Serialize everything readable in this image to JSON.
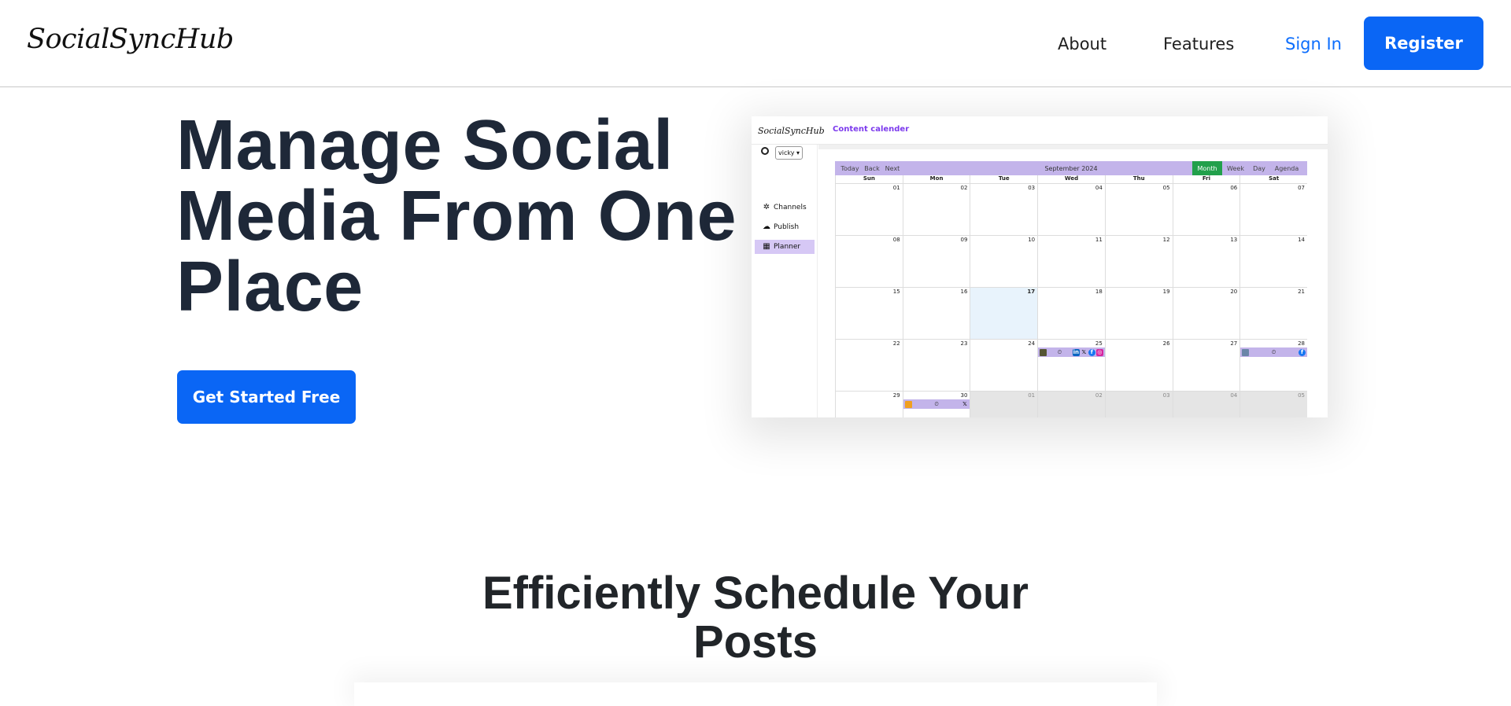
{
  "nav": {
    "brand": "SocialSyncHub",
    "about": "About",
    "features": "Features",
    "sign_in": "Sign In",
    "register": "Register"
  },
  "hero": {
    "title": "Manage Social Media From One Place",
    "cta": "Get Started Free"
  },
  "preview": {
    "brand": "SocialSyncHub",
    "heading": "Content calender",
    "user": "vicky ▾",
    "sidebar": [
      {
        "label": "Channels",
        "icon": "asterisk-icon"
      },
      {
        "label": "Publish",
        "icon": "cloud-icon"
      },
      {
        "label": "Planner",
        "icon": "calendar-icon"
      }
    ],
    "toolbar": {
      "today": "Today",
      "back": "Back",
      "next": "Next",
      "month_label": "September 2024",
      "views": [
        "Month",
        "Week",
        "Day",
        "Agenda"
      ],
      "active_view": "Month"
    },
    "weekdays": [
      "Sun",
      "Mon",
      "Tue",
      "Wed",
      "Thu",
      "Fri",
      "Sat"
    ],
    "weeks": [
      [
        "01",
        "02",
        "03",
        "04",
        "05",
        "06",
        "07"
      ],
      [
        "08",
        "09",
        "10",
        "11",
        "12",
        "13",
        "14"
      ],
      [
        "15",
        "16",
        "17",
        "18",
        "19",
        "20",
        "21"
      ],
      [
        "22",
        "23",
        "24",
        "25",
        "26",
        "27",
        "28"
      ],
      [
        "29",
        "30",
        "01",
        "02",
        "03",
        "04",
        "05"
      ]
    ],
    "today": "17"
  },
  "section": {
    "title": "Efficiently Schedule Your Posts"
  }
}
